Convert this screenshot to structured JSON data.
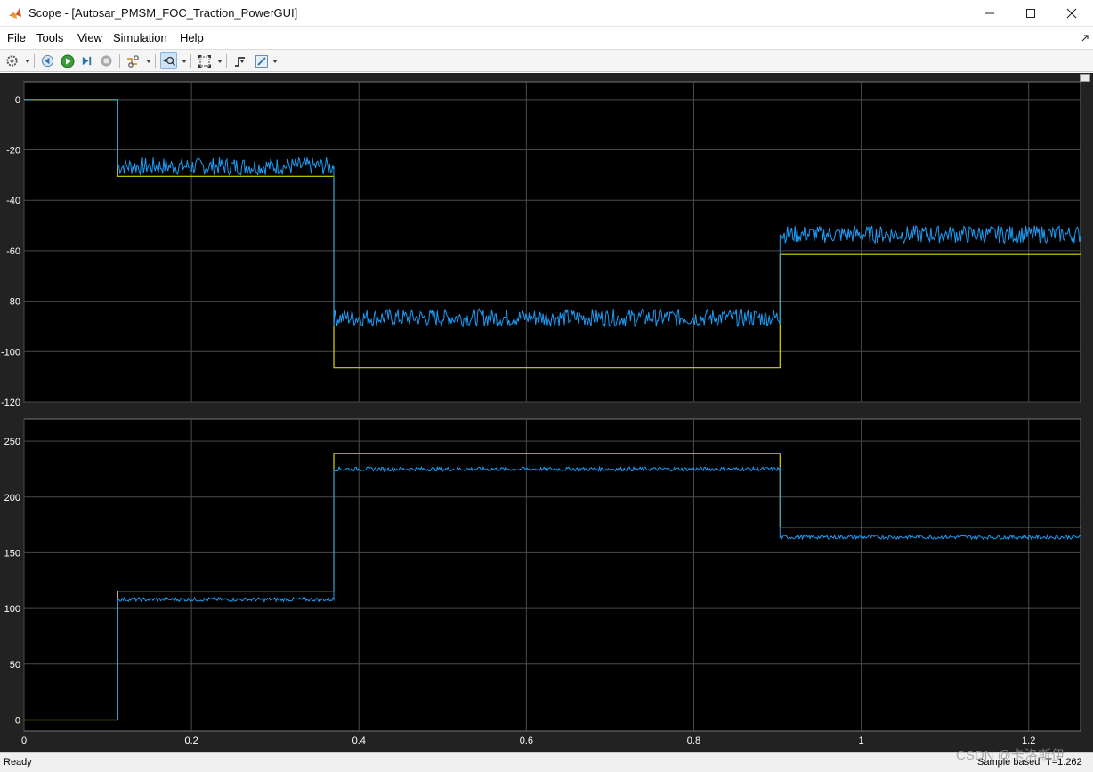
{
  "window": {
    "title": "Scope - [Autosar_PMSM_FOC_Traction_PowerGUI]",
    "controls": [
      "minimize-icon",
      "maximize-icon",
      "close-icon"
    ]
  },
  "menu": {
    "file": "File",
    "tools": "Tools",
    "view": "View",
    "simulation": "Simulation",
    "help": "Help",
    "undock_icon": "undock-icon"
  },
  "toolbar": {
    "icons": [
      "settings-gear-icon",
      "step-back-icon",
      "run-icon",
      "step-forward-icon",
      "stop-icon",
      "signal-highlight-icon",
      "zoom-icon",
      "autoscale-icon",
      "trigger-icon",
      "measure-icon"
    ]
  },
  "colors": {
    "axes_bg": "#000000",
    "figure_bg": "#222222",
    "grid": "#4a4a4a",
    "tick_text": "#ffffff",
    "signal_yellow": "#d8d800",
    "signal_blue": "#1c9cf5"
  },
  "status": {
    "ready": "Ready",
    "sample_mode": "Sample based",
    "time": "T=1.262"
  },
  "watermark": "CSDN @卡洛斯伊",
  "chart_data": [
    {
      "type": "line",
      "title": "",
      "xlabel": "",
      "ylabel": "",
      "xlim": [
        0,
        1.262
      ],
      "ylim": [
        -120,
        7
      ],
      "xticks": [
        0,
        0.2,
        0.4,
        0.6,
        0.8,
        1,
        1.2
      ],
      "xtick_labels": [
        "0",
        "0.2",
        "0.4",
        "0.6",
        "0.8",
        "1",
        "1.2"
      ],
      "yticks": [
        0,
        -20,
        -40,
        -60,
        -80,
        -100,
        -120
      ],
      "ytick_labels": [
        "0",
        "-20",
        "-40",
        "-60",
        "-80",
        "-100",
        "-120"
      ],
      "grid": true,
      "series": [
        {
          "color": "#d8d800",
          "x": [
            0,
            0.112,
            0.112,
            0.37,
            0.37,
            0.903,
            0.903,
            1.262
          ],
          "y": [
            0,
            0,
            -30.5,
            -30.5,
            -106.5,
            -106.5,
            -61.5,
            -61.5
          ]
        },
        {
          "color": "#1c9cf5",
          "x": [
            0,
            0.112,
            0.112,
            0.37,
            0.37,
            0.903,
            0.903,
            1.262
          ],
          "y": [
            0,
            0,
            -26.5,
            -26.5,
            -86.5,
            -86.5,
            -53.5,
            -53.5
          ],
          "noise": 3.5
        }
      ]
    },
    {
      "type": "line",
      "title": "",
      "xlabel": "",
      "ylabel": "",
      "xlim": [
        0,
        1.262
      ],
      "ylim": [
        -10,
        270
      ],
      "xticks": [
        0,
        0.2,
        0.4,
        0.6,
        0.8,
        1,
        1.2
      ],
      "xtick_labels": [
        "0",
        "0.2",
        "0.4",
        "0.6",
        "0.8",
        "1",
        "1.2"
      ],
      "yticks": [
        0,
        50,
        100,
        150,
        200,
        250
      ],
      "ytick_labels": [
        "0",
        "50",
        "100",
        "150",
        "200",
        "250"
      ],
      "grid": true,
      "series": [
        {
          "color": "#d8d800",
          "x": [
            0,
            0.112,
            0.112,
            0.37,
            0.37,
            0.903,
            0.903,
            1.262
          ],
          "y": [
            0,
            0,
            115.5,
            115.5,
            239,
            239,
            173,
            173
          ]
        },
        {
          "color": "#1c9cf5",
          "x": [
            0,
            0.112,
            0.112,
            0.37,
            0.37,
            0.903,
            0.903,
            1.262
          ],
          "y": [
            0,
            0,
            108,
            108,
            225,
            225,
            164,
            164
          ],
          "noise": 1.8
        }
      ]
    }
  ]
}
